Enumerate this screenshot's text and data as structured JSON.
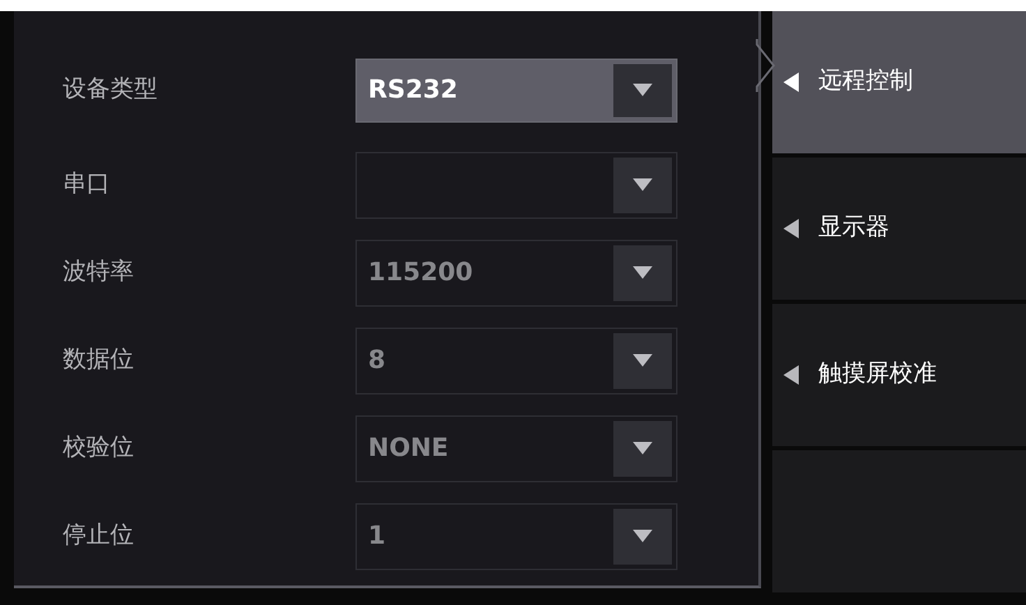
{
  "settings": [
    {
      "label": "设备类型",
      "value": "RS232",
      "disabled": false
    },
    {
      "label": "串口",
      "disabled": true
    },
    {
      "label": "波特率",
      "value": "115200",
      "disabled": true
    },
    {
      "label": "数据位",
      "value": "8",
      "disabled": true
    },
    {
      "label": "校验位",
      "value": "NONE",
      "disabled": true
    },
    {
      "label": "停止位",
      "value": "1",
      "disabled": true
    }
  ],
  "menu": [
    {
      "label": "远程控制",
      "selected": true
    },
    {
      "label": "显示器",
      "selected": false
    },
    {
      "label": "触摸屏校准",
      "selected": false
    },
    {
      "selected": false
    }
  ]
}
